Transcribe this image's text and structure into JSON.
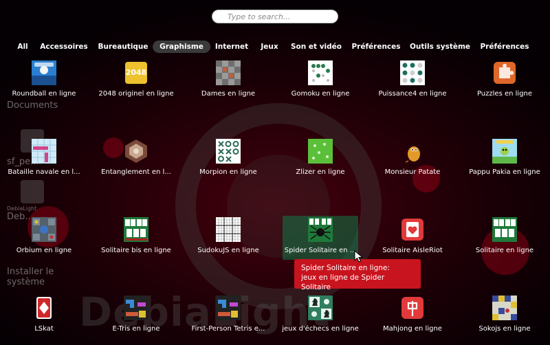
{
  "search": {
    "placeholder": "Type to search..."
  },
  "categories": [
    {
      "label": "All",
      "active": false
    },
    {
      "label": "Accessoires",
      "active": false
    },
    {
      "label": "Bureautique",
      "active": false
    },
    {
      "label": "Graphisme",
      "active": true
    },
    {
      "label": "Internet",
      "active": false
    },
    {
      "label": "Jeux",
      "active": false
    },
    {
      "label": "Son et vidéo",
      "active": false
    },
    {
      "label": "Préférences",
      "active": false
    },
    {
      "label": "Outils système",
      "active": false
    },
    {
      "label": "Préférences",
      "active": false
    }
  ],
  "apps": [
    {
      "label": "Roundball en ligne",
      "icon": "roundball-icon"
    },
    {
      "label": "2048 originel en ligne",
      "icon": "tile-2048-icon",
      "icon_text": "2048"
    },
    {
      "label": "Dames en ligne",
      "icon": "checkers-icon"
    },
    {
      "label": "Gomoku en ligne",
      "icon": "gomoku-icon"
    },
    {
      "label": "Puissance4 en ligne",
      "icon": "connect-four-icon"
    },
    {
      "label": "Puzzles en ligne",
      "icon": "puzzle-piece-icon"
    },
    {
      "label": "Bataille navale en l...",
      "icon": "battleship-icon"
    },
    {
      "label": "Entanglement en l...",
      "icon": "hexagon-board-icon"
    },
    {
      "label": "Morpion en ligne",
      "icon": "tic-tac-toe-icon"
    },
    {
      "label": "Zlizer en ligne",
      "icon": "zlizer-icon"
    },
    {
      "label": "Monsieur Patate",
      "icon": "potato-man-icon"
    },
    {
      "label": "Pappu Pakia en ligne",
      "icon": "pappu-pakia-icon"
    },
    {
      "label": "Orbium en ligne",
      "icon": "orbium-icon"
    },
    {
      "label": "Solitaire bis en ligne",
      "icon": "solitaire-cards-icon"
    },
    {
      "label": "SudokuJS en ligne",
      "icon": "sudoku-grid-icon"
    },
    {
      "label": "Spider Solitaire en ...",
      "icon": "spider-icon",
      "selected": true
    },
    {
      "label": "Solitaire AisleRiot",
      "icon": "playing-card-heart-icon"
    },
    {
      "label": "Solitaire en ligne",
      "icon": "solitaire-cards-icon"
    },
    {
      "label": "LSkat",
      "icon": "card-diamond-icon"
    },
    {
      "label": "E-Tris en ligne",
      "icon": "tetris-blocks-icon"
    },
    {
      "label": "First-Person Tetris e...",
      "icon": "tetris-blocks-icon"
    },
    {
      "label": "jeux d'échecs en ligne",
      "icon": "chess-pieces-icon"
    },
    {
      "label": "Mahjong en ligne",
      "icon": "mahjong-tile-icon"
    },
    {
      "label": "Sokojs en ligne",
      "icon": "sokoban-icon"
    }
  ],
  "tooltip": {
    "title": "Spider Solitaire en ligne:",
    "description": "jeux en ligne de Spider Solitaire"
  },
  "desktop": {
    "items": [
      {
        "label": "Documents"
      },
      {
        "label": "sf_pe..."
      },
      {
        "label": "DebiaLight"
      },
      {
        "label": "Deb..."
      },
      {
        "label": "Installer le système"
      }
    ],
    "watermark": "DebiaLight"
  },
  "colors": {
    "tooltip_bg": "#c8141e",
    "selected_bg": "#127848",
    "active_tab": "#3a3a3a"
  }
}
